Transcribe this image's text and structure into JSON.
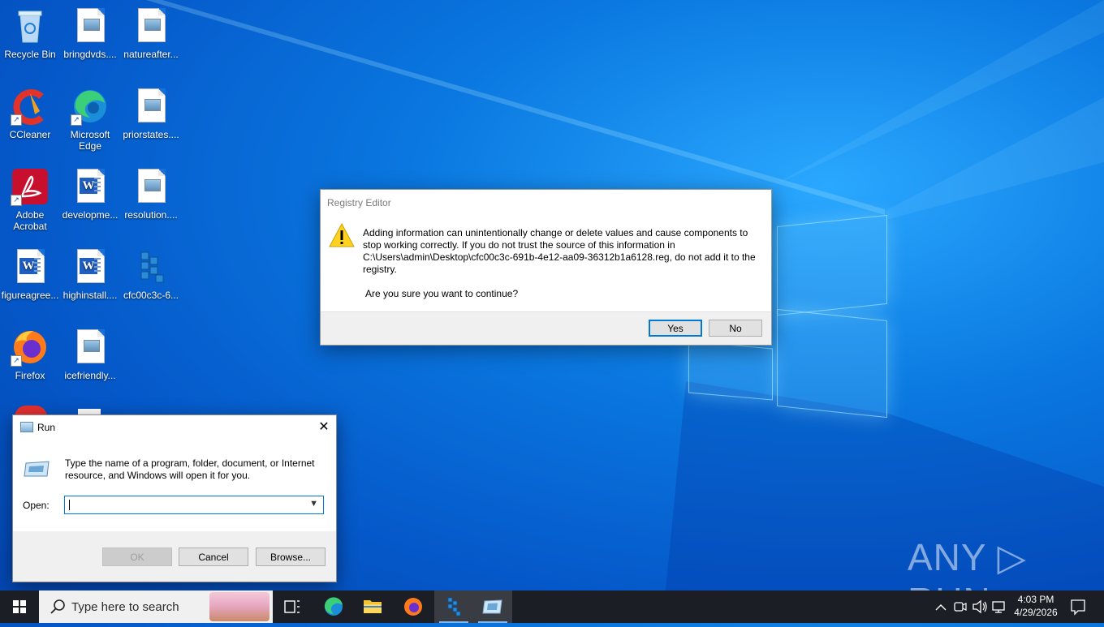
{
  "desktop": {
    "icons": [
      {
        "label": "Recycle Bin"
      },
      {
        "label": "bringdvds...."
      },
      {
        "label": "natureafter..."
      },
      {
        "label": "CCleaner"
      },
      {
        "label": "Microsoft Edge"
      },
      {
        "label": "priorstates...."
      },
      {
        "label": "Adobe Acrobat"
      },
      {
        "label": "developme..."
      },
      {
        "label": "resolution...."
      },
      {
        "label": "figureagree..."
      },
      {
        "label": "highinstall...."
      },
      {
        "label": "cfc00c3c-6..."
      },
      {
        "label": "Firefox"
      },
      {
        "label": "icefriendly..."
      }
    ]
  },
  "registry_dialog": {
    "title": "Registry Editor",
    "message": "Adding information can unintentionally change or delete values and cause components to stop working correctly. If you do not trust the source of this information in C:\\Users\\admin\\Desktop\\cfc00c3c-691b-4e12-aa09-36312b1a6128.reg, do not add it to the registry.",
    "question": "Are you sure you want to continue?",
    "yes_label": "Yes",
    "no_label": "No"
  },
  "run_dialog": {
    "title": "Run",
    "close_glyph": "✕",
    "description": "Type the name of a program, folder, document, or Internet resource, and Windows will open it for you.",
    "open_label": "Open:",
    "open_value": "",
    "ok_label": "OK",
    "cancel_label": "Cancel",
    "browse_label": "Browse..."
  },
  "taskbar": {
    "search_placeholder": "Type here to search",
    "time": "4:03 PM",
    "date": "4/29/2026"
  },
  "watermark": "ANY ▷ RUN",
  "colors": {
    "accent": "#0078d7",
    "taskbar": "#1c1e25"
  }
}
